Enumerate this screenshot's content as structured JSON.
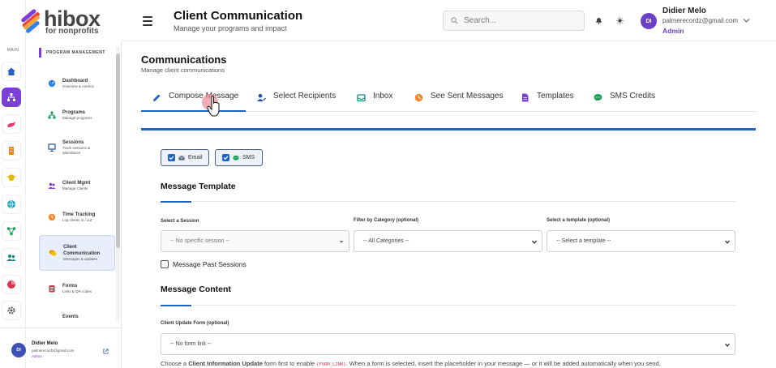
{
  "brand": {
    "name": "hibox",
    "tagline": "for nonprofits"
  },
  "rail": {
    "section_label": "MAIN"
  },
  "sidebar": {
    "section_label": "PROGRAM MANAGEMENT",
    "items": [
      {
        "label": "Dashboard",
        "sub": "Overview & metrics"
      },
      {
        "label": "Programs",
        "sub": "Manage programs"
      },
      {
        "label": "Sessions",
        "sub": "Track sessions & attendance"
      },
      {
        "label": "Client Mgmt",
        "sub": "Manage Clients"
      },
      {
        "label": "Time Tracking",
        "sub": "Log clients in / out"
      },
      {
        "label": "Client Communication",
        "sub": "Messages & updates"
      },
      {
        "label": "Forms",
        "sub": "Links & QR codes"
      },
      {
        "label": "Events",
        "sub": ""
      }
    ],
    "user": {
      "initials": "DI",
      "name": "Didier Melo",
      "email": "palmerecordz@gmail.com",
      "role": "Admin"
    }
  },
  "header": {
    "title": "Client Communication",
    "subtitle": "Manage your programs and impact",
    "search_placeholder": "Search...",
    "user": {
      "initials": "DI",
      "name": "Didier Melo",
      "email": "palmerecordz@gmail.com",
      "role": "Admin"
    }
  },
  "main": {
    "title": "Communications",
    "subtitle": "Manage client communications",
    "tabs": [
      {
        "label": "Compose Message",
        "icon": "pencil-icon"
      },
      {
        "label": "Select Recipients",
        "icon": "user-edit-icon"
      },
      {
        "label": "Inbox",
        "icon": "inbox-icon"
      },
      {
        "label": "See Sent Messages",
        "icon": "clock-icon"
      },
      {
        "label": "Templates",
        "icon": "file-icon"
      },
      {
        "label": "SMS Credits",
        "icon": "sms-icon"
      }
    ],
    "channels": {
      "email": "Email",
      "sms": "SMS"
    },
    "template_section": {
      "heading": "Message Template",
      "session_label": "Select a Session",
      "session_value": "-- No specific session --",
      "category_label": "Filter by Category (optional)",
      "category_value": "-- All Categories --",
      "template_label": "Select a template (optional)",
      "template_value": "-- Select a template --",
      "past_sessions_label": "Message Past Sessions"
    },
    "content_section": {
      "heading": "Message Content",
      "form_label": "Client Update Form (optional)",
      "form_value": "-- No form link --",
      "help_pre": "Choose a ",
      "help_bold": "Client Information Update",
      "help_mid": " form first to enable ",
      "help_code": "{FORM_LINK}",
      "help_post": ". When a form is selected, insert the placeholder in your message — or it will be added automatically when you send."
    }
  },
  "colors": {
    "accent": "#1f63c6",
    "brand_purple": "#7b3fd6"
  }
}
